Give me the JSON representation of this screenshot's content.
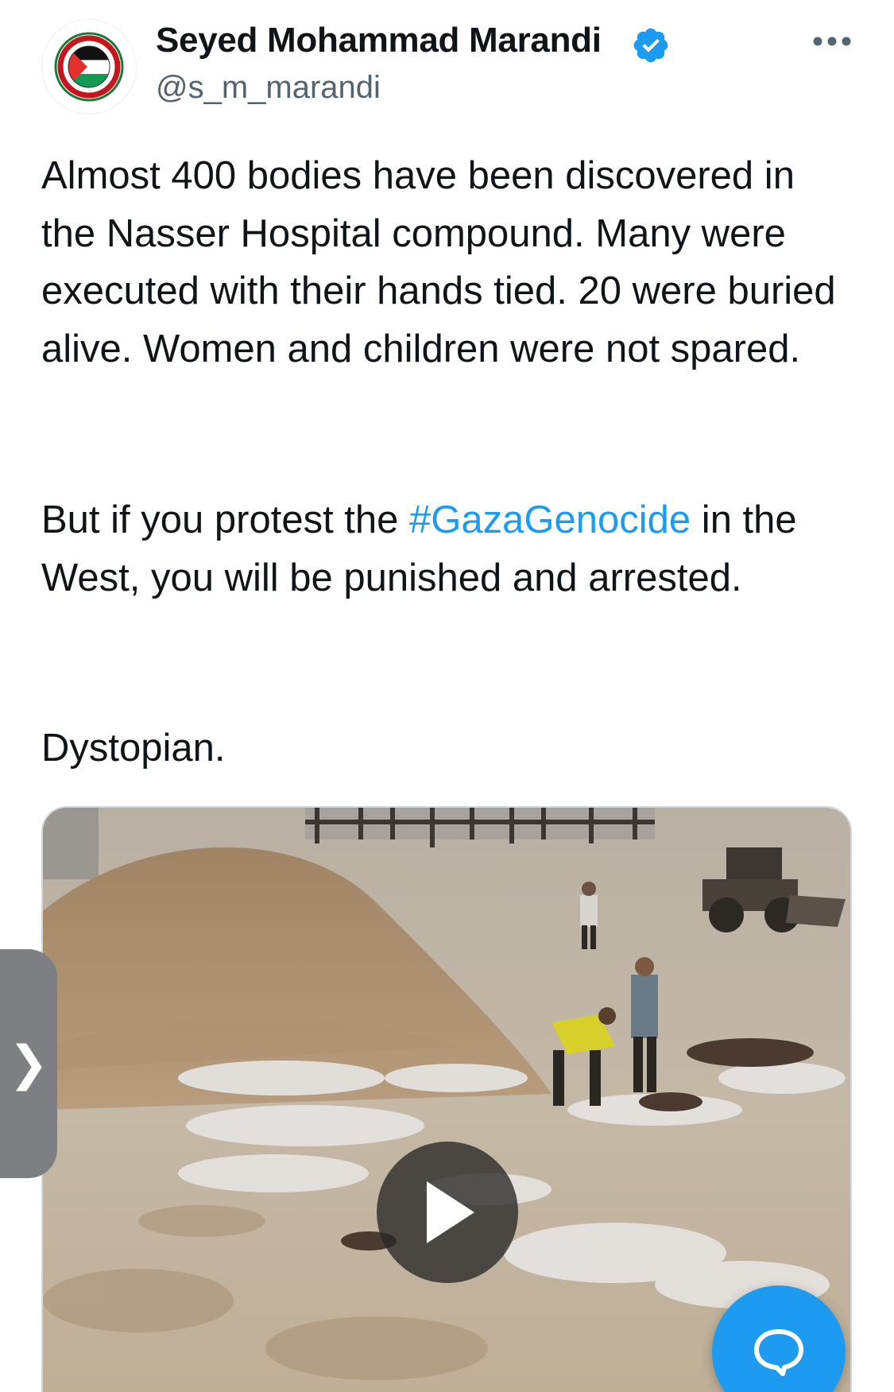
{
  "author": {
    "name": "Seyed Mohammad Marandi",
    "handle": "@s_m_marandi",
    "avatar_icon": "save-gaza-palestine-flag-logo",
    "avatar_ring_text_top": "SAVE GAZA",
    "avatar_ring_text_bottom": "SAVE PALESTINE",
    "verified": true,
    "verified_color": "#1d9bf0"
  },
  "tweet": {
    "paragraph1": "Almost 400 bodies have been discovered in the Nasser Hospital compound. Many were executed with their hands tied. 20 were buried alive. Women and children were not spared.",
    "paragraph2_before": "But if you protest the ",
    "paragraph2_hashtag": "#GazaGenocide",
    "paragraph2_after": " in the West, you will be punished and arrested.",
    "paragraph3": "Dystopian."
  },
  "media": {
    "type": "video",
    "play_icon": "play-icon"
  },
  "controls": {
    "more_icon": "more-horizontal-icon",
    "side_handle_glyph": "❯",
    "reply_icon": "speech-bubble-icon"
  },
  "colors": {
    "text": "#0f1419",
    "secondary_text": "#536471",
    "link": "#1d9bf0",
    "fab": "#1d9bf0"
  }
}
